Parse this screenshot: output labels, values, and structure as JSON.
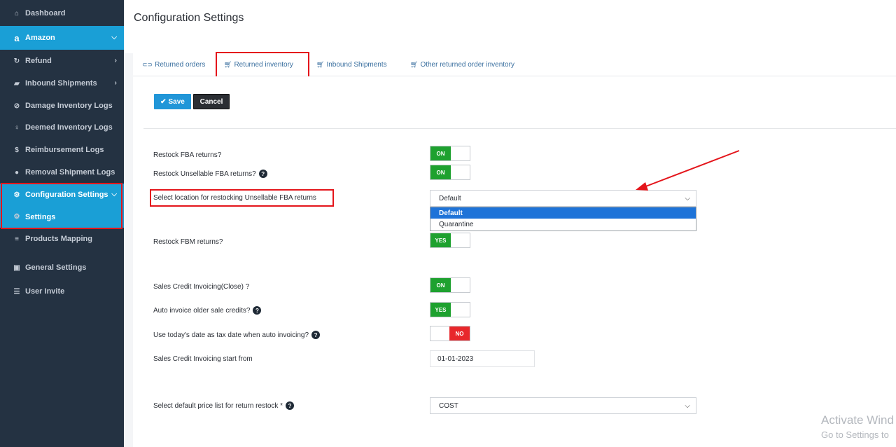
{
  "sidebar": {
    "items": [
      {
        "label": "Dashboard",
        "icon": "home-icon"
      },
      {
        "label": "Amazon",
        "icon": "amazon-icon"
      },
      {
        "label": "Refund",
        "icon": "refresh-icon"
      },
      {
        "label": "Inbound Shipments",
        "icon": "truck-icon"
      },
      {
        "label": "Damage Inventory Logs",
        "icon": "broken-link-icon"
      },
      {
        "label": "Deemed Inventory Logs",
        "icon": "lightbulb-icon"
      },
      {
        "label": "Reimbursement Logs",
        "icon": "dollar-icon"
      },
      {
        "label": "Removal Shipment Logs",
        "icon": "circle-icon"
      },
      {
        "label": "Configuration Settings",
        "icon": "gears-icon"
      },
      {
        "label": "Settings",
        "icon": "gear-icon"
      },
      {
        "label": "Products Mapping",
        "icon": "list-icon"
      },
      {
        "label": "General Settings",
        "icon": "settings-box-icon"
      },
      {
        "label": "User Invite",
        "icon": "user-list-icon"
      }
    ]
  },
  "header": {
    "title": "Configuration Settings"
  },
  "tabs": [
    {
      "label": "Returned orders",
      "icon": "link-icon"
    },
    {
      "label": "Returned inventory",
      "icon": "cart-icon"
    },
    {
      "label": "Inbound Shipments",
      "icon": "cart-icon"
    },
    {
      "label": "Other returned order inventory",
      "icon": "cart-icon"
    }
  ],
  "toolbar": {
    "save_label": "Save",
    "cancel_label": "Cancel"
  },
  "form": {
    "restock_fba": {
      "label": "Restock FBA returns?",
      "value": "ON"
    },
    "restock_unsellable": {
      "label": "Restock Unsellable FBA returns?",
      "value": "ON"
    },
    "location": {
      "label": "Select location for restocking Unsellable FBA returns",
      "value": "Default",
      "options": [
        "Default",
        "Quarantine"
      ]
    },
    "restock_fbm": {
      "label": "Restock FBM returns?",
      "value": "YES"
    },
    "sales_credit_close": {
      "label": "Sales Credit Invoicing(Close) ?",
      "value": "ON"
    },
    "auto_invoice": {
      "label": "Auto invoice older sale credits?",
      "value": "YES"
    },
    "todays_date": {
      "label": "Use today's date as tax date when auto invoicing?",
      "value": "NO"
    },
    "start_from": {
      "label": "Sales Credit Invoicing start from",
      "value": "01-01-2023"
    },
    "price_list": {
      "label": "Select default price list for return restock *",
      "value": "COST"
    }
  },
  "help_glyph": "?",
  "watermark": {
    "line1": "Activate Wind",
    "line2": "Go to Settings to"
  },
  "colors": {
    "sidebar": "#243242",
    "active": "#1a9fd6",
    "on": "#1ea12f",
    "off": "#e8272b",
    "highlight": "#e4151b"
  }
}
